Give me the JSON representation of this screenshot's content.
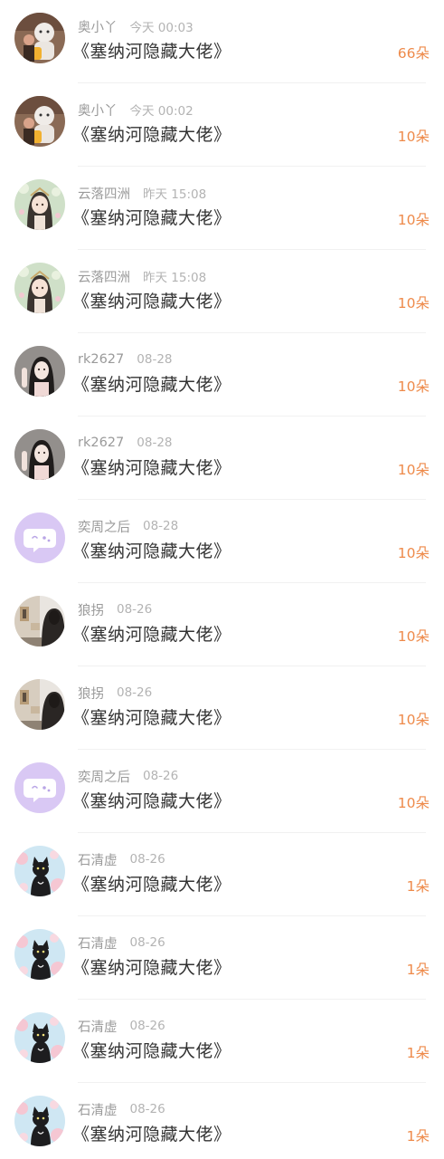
{
  "colors": {
    "name": "#9a9a9a",
    "time": "#b3b3b3",
    "title": "#333333",
    "gift": "#ee8a4a",
    "divider": "#f1f1f1"
  },
  "rows": [
    {
      "name": "奥小丫",
      "time": "今天 00:03",
      "book": "《塞纳河隐藏大佬》",
      "gift": "66朵",
      "avatar": "user-photo-icon"
    },
    {
      "name": "奥小丫",
      "time": "今天 00:02",
      "book": "《塞纳河隐藏大佬》",
      "gift": "10朵",
      "avatar": "user-photo-icon"
    },
    {
      "name": "云落四洲",
      "time": "昨天 15:08",
      "book": "《塞纳河隐藏大佬》",
      "gift": "10朵",
      "avatar": "anime-girl-avatar-icon"
    },
    {
      "name": "云落四洲",
      "time": "昨天 15:08",
      "book": "《塞纳河隐藏大佬》",
      "gift": "10朵",
      "avatar": "anime-girl-avatar-icon"
    },
    {
      "name": "rk2627",
      "time": "08-28",
      "book": "《塞纳河隐藏大佬》",
      "gift": "10朵",
      "avatar": "girl-photo-avatar-icon"
    },
    {
      "name": "rk2627",
      "time": "08-28",
      "book": "《塞纳河隐藏大佬》",
      "gift": "10朵",
      "avatar": "girl-photo-avatar-icon"
    },
    {
      "name": "奕周之后",
      "time": "08-28",
      "book": "《塞纳河隐藏大佬》",
      "gift": "10朵",
      "avatar": "default-chat-bubble-avatar-icon"
    },
    {
      "name": "狼拐",
      "time": "08-26",
      "book": "《塞纳河隐藏大佬》",
      "gift": "10朵",
      "avatar": "street-photo-avatar-icon"
    },
    {
      "name": "狼拐",
      "time": "08-26",
      "book": "《塞纳河隐藏大佬》",
      "gift": "10朵",
      "avatar": "street-photo-avatar-icon"
    },
    {
      "name": "奕周之后",
      "time": "08-26",
      "book": "《塞纳河隐藏大佬》",
      "gift": "10朵",
      "avatar": "default-chat-bubble-avatar-icon"
    },
    {
      "name": "石清虚",
      "time": "08-26",
      "book": "《塞纳河隐藏大佬》",
      "gift": "1朵",
      "avatar": "black-cat-avatar-icon"
    },
    {
      "name": "石清虚",
      "time": "08-26",
      "book": "《塞纳河隐藏大佬》",
      "gift": "1朵",
      "avatar": "black-cat-avatar-icon"
    },
    {
      "name": "石清虚",
      "time": "08-26",
      "book": "《塞纳河隐藏大佬》",
      "gift": "1朵",
      "avatar": "black-cat-avatar-icon"
    },
    {
      "name": "石清虚",
      "time": "08-26",
      "book": "《塞纳河隐藏大佬》",
      "gift": "1朵",
      "avatar": "black-cat-avatar-icon"
    }
  ]
}
